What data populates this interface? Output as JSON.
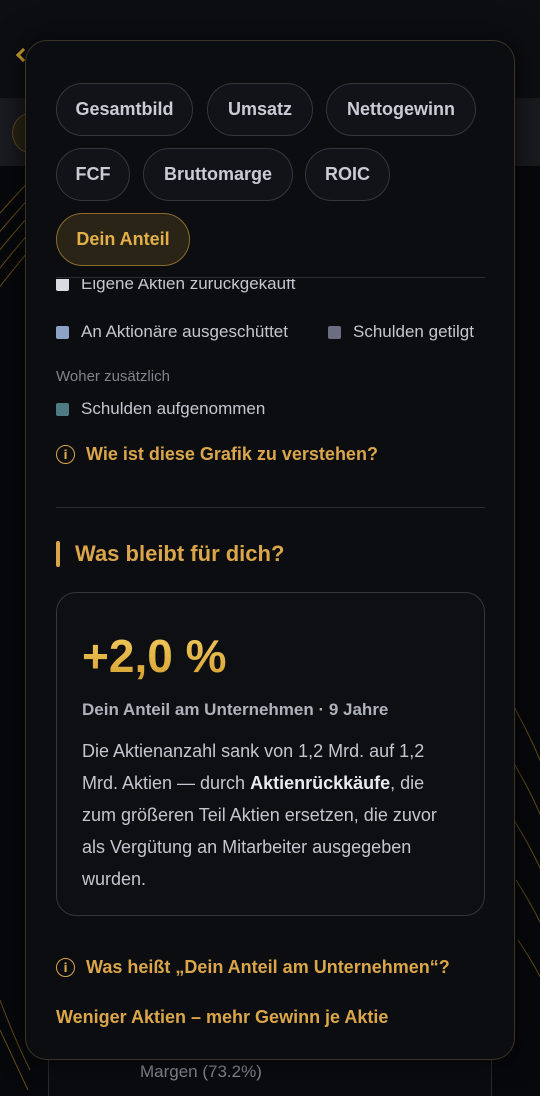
{
  "background": {
    "behind_text": "Margen (73.2%)"
  },
  "tabs": [
    {
      "label": "Gesamtbild",
      "active": false
    },
    {
      "label": "Umsatz",
      "active": false
    },
    {
      "label": "Nettogewinn",
      "active": false
    },
    {
      "label": "FCF",
      "active": false
    },
    {
      "label": "Bruttomarge",
      "active": false
    },
    {
      "label": "ROIC",
      "active": false
    },
    {
      "label": "Dein Anteil",
      "active": true
    }
  ],
  "legend": {
    "items": [
      {
        "label": "Eigene Aktien zurückgekauft",
        "color": "#d9dbe3"
      },
      {
        "label": "An Aktionäre ausgeschüttet",
        "color": "#8ea2c6"
      },
      {
        "label": "Schulden getilgt",
        "color": "#6b6e82"
      }
    ],
    "section_label": "Woher zusätzlich",
    "extra_items": [
      {
        "label": "Schulden aufgenommen",
        "color": "#4f7a84"
      }
    ]
  },
  "help_link": {
    "icon": "info-icon",
    "label": "Wie ist diese Grafik zu verstehen?"
  },
  "section": {
    "title": "Was bleibt für dich?"
  },
  "result": {
    "value": "+2,0 %",
    "subtitle": "Dein Anteil am Unternehmen · 9 Jahre",
    "body_part1": "Die Aktienanzahl sank von 1,2 Mrd. auf 1,2 Mrd. Aktien — durch ",
    "body_bold": "Aktienrückkäufe",
    "body_part2": ", die zum größeren Teil Aktien ersetzen, die zuvor als Vergütung an Mitarbeiter ausgegeben wurden."
  },
  "faq_link": {
    "icon": "info-icon",
    "label": "Was heißt „Dein Anteil am Unternehmen“?"
  },
  "bottom": {
    "heading": "Weniger Aktien – mehr Gewinn je Aktie"
  },
  "colors": {
    "accent": "#dba64a",
    "background": "#0c0d10"
  }
}
